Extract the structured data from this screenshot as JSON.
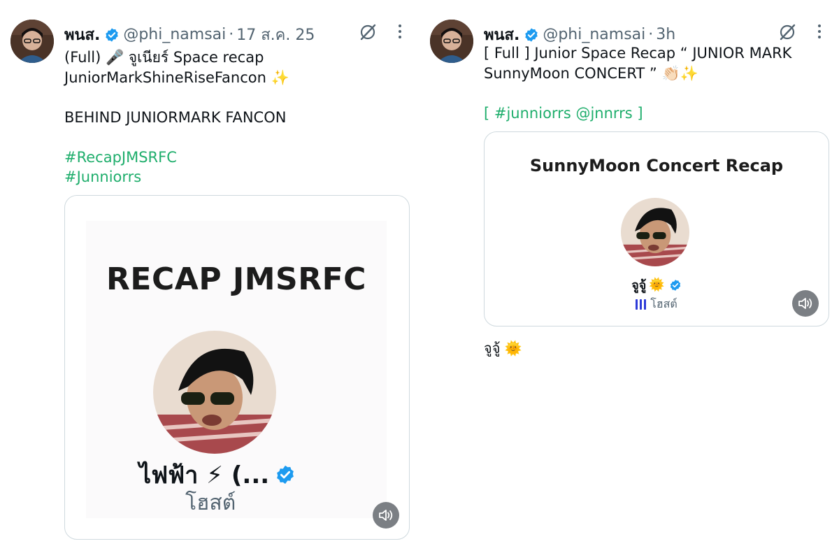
{
  "tweets": [
    {
      "display_name": "พนส.",
      "handle": "@phi_namsai",
      "separator": "·",
      "time": "17 ส.ค. 25",
      "lines": [
        {
          "text": "(Full) 🎤 จูเนียร์ Space recap",
          "type": "text"
        },
        {
          "text": "JuniorMarkShineRiseFancon ✨",
          "type": "text"
        },
        {
          "text": "",
          "type": "blank"
        },
        {
          "text": "BEHIND JUNIORMARK FANCON",
          "type": "text"
        },
        {
          "text": "",
          "type": "blank"
        },
        {
          "text": "#RecapJMSRFC",
          "type": "hashtag"
        },
        {
          "text": "#Junniorrs",
          "type": "hashtag"
        }
      ],
      "card": {
        "title": "RECAP JMSRFC",
        "host_name": "ไฟฟ้า ⚡ (...",
        "host_role": "โฮสต์"
      }
    },
    {
      "display_name": "พนส.",
      "handle": "@phi_namsai",
      "separator": "·",
      "time": "3h",
      "lines": [
        {
          "text": "[ Full ] Junior Space Recap “ JUNIOR MARK",
          "type": "text"
        },
        {
          "text": "SunnyMoon CONCERT ” 👏🏻✨",
          "type": "text"
        },
        {
          "text": "",
          "type": "blank"
        }
      ],
      "tag_line": {
        "open": "[ ",
        "tag1": "#junniorrs",
        "space": " ",
        "tag2": "@jnnrrs",
        "close": " ]"
      },
      "card": {
        "title": "SunnyMoon Concert Recap",
        "host_name": "จูจู้",
        "host_emoji": "🌞",
        "host_role": "โฮสต์"
      },
      "caption": {
        "text": "จูจู้",
        "emoji": "🌞"
      }
    }
  ],
  "colors": {
    "hashtag": "#1fae6c",
    "verified": "#1d9bf0",
    "muted": "#536471",
    "border": "#cfd9de",
    "host_bars": "#2d3bd8",
    "sound_button": "#7b7f84"
  },
  "icons": [
    "verified-badge-icon",
    "grok-icon",
    "more-icon",
    "speaker-icon",
    "audio-bars-icon"
  ]
}
